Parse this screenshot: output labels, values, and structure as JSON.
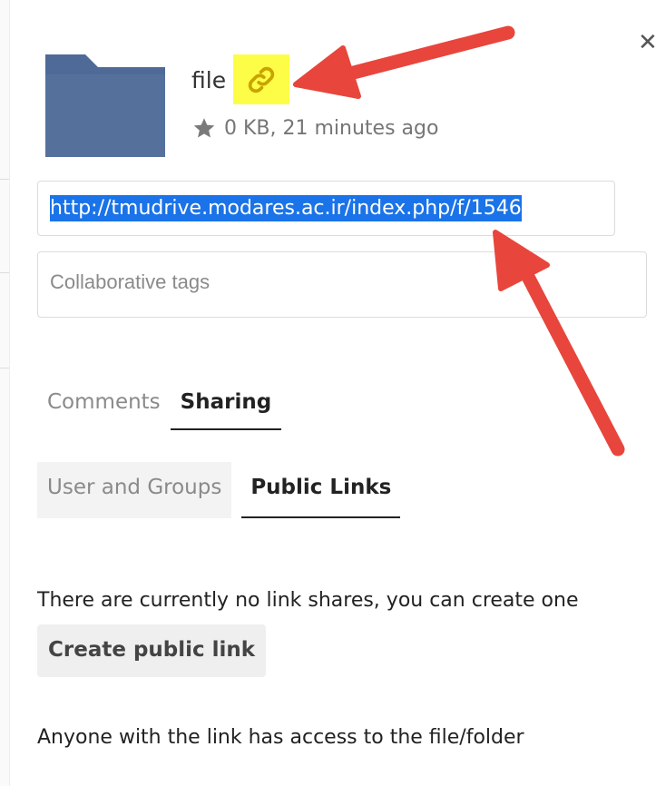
{
  "file": {
    "name": "file",
    "meta": "0 KB, 21 minutes ago",
    "folder_color": "#4f6a97"
  },
  "link_field": {
    "value": "http://tmudrive.modares.ac.ir/index.php/f/1546"
  },
  "tags_field": {
    "placeholder": "Collaborative tags"
  },
  "tabs": [
    {
      "label": "Comments",
      "active": false
    },
    {
      "label": "Sharing",
      "active": true
    }
  ],
  "sharing_subtabs": [
    {
      "label": "User and Groups",
      "active": false
    },
    {
      "label": "Public Links",
      "active": true
    }
  ],
  "public_links": {
    "empty_message": "There are currently no link shares, you can create one",
    "create_label": "Create public link",
    "access_note": "Anyone with the link has access to the file/folder"
  },
  "colors": {
    "annotation_arrow": "#e8453c",
    "highlight": "#fdfd48",
    "link_icon": "#c9a400",
    "selection": "#1a73e8"
  },
  "icons": [
    "folder-icon",
    "link-icon",
    "close-icon",
    "star-icon"
  ]
}
